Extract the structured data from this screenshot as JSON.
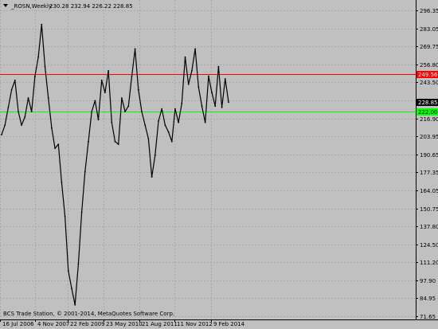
{
  "header": {
    "symbol": "_ROSN,Weekly",
    "ohlc": "230.28 232.94 226.22 228.85",
    "menu_icon": "triangle-down-icon"
  },
  "footer": {
    "copyright": "BCS Trade Station, © 2001-2014, MetaQuotes Software Corp."
  },
  "colors": {
    "background": "#c0c0c0",
    "grid": "#a8a8a8",
    "price_line": "#000000",
    "resistance_line": "#ff0000",
    "support_line": "#00ff00"
  },
  "chart_data": {
    "type": "line",
    "title": "",
    "xlabel": "",
    "ylabel": "",
    "y_axis_ticks": [
      "296.35",
      "283.05",
      "269.75",
      "256.80",
      "243.50",
      "230.20",
      "216.90",
      "203.95",
      "190.65",
      "177.35",
      "164.05",
      "150.75",
      "137.80",
      "124.50",
      "111.20",
      "97.90",
      "84.95",
      "71.65"
    ],
    "x_axis_ticks": [
      "16 Jul 2006",
      "4 Nov 2007",
      "22 Feb 2009",
      "23 May 2010",
      "21 Aug 2011",
      "11 Nov 2012",
      "9 Feb 2014"
    ],
    "ylim": [
      71.65,
      296.35
    ],
    "grid": true,
    "current_price": {
      "value": 228.85,
      "label": "228.85"
    },
    "horizontal_levels": [
      {
        "value": 249.56,
        "label": "249.56",
        "color": "#ff0000"
      },
      {
        "value": 222.0,
        "label": "222.00",
        "color": "#00ff00"
      }
    ],
    "series": [
      {
        "x": [
          "2006-07-16",
          "2006-08-27",
          "2006-10-08",
          "2006-11-19",
          "2006-12-31",
          "2007-02-11",
          "2007-03-25",
          "2007-05-06",
          "2007-06-17",
          "2007-07-29",
          "2007-09-09",
          "2007-10-21",
          "2007-12-02",
          "2008-01-13",
          "2008-02-24",
          "2008-04-06",
          "2008-05-18",
          "2008-06-29",
          "2008-08-10",
          "2008-09-21",
          "2008-11-02",
          "2008-12-14",
          "2009-01-25",
          "2009-03-08",
          "2009-04-19",
          "2009-05-31",
          "2009-07-12",
          "2009-08-23",
          "2009-10-04",
          "2009-11-15",
          "2009-12-27",
          "2010-02-07",
          "2010-03-21",
          "2010-05-02",
          "2010-06-13",
          "2010-07-25",
          "2010-09-05",
          "2010-10-17",
          "2010-11-28",
          "2011-01-09",
          "2011-02-20",
          "2011-04-03",
          "2011-05-15",
          "2011-06-26",
          "2011-08-07",
          "2011-09-18",
          "2011-10-30",
          "2011-12-11",
          "2012-01-22",
          "2012-03-04",
          "2012-04-15",
          "2012-05-27",
          "2012-07-08",
          "2012-08-19",
          "2012-09-30",
          "2012-11-11",
          "2012-12-23",
          "2013-02-03",
          "2013-03-17",
          "2013-04-28",
          "2013-06-09",
          "2013-07-21",
          "2013-09-01",
          "2013-10-13",
          "2013-11-24",
          "2014-01-05",
          "2014-02-16",
          "2014-03-30",
          "2014-05-11"
        ],
        "values": [
          205,
          212,
          225,
          238,
          245,
          222,
          212,
          218,
          232,
          222,
          248,
          262,
          286,
          255,
          232,
          210,
          195,
          198,
          170,
          145,
          105,
          92,
          80,
          110,
          148,
          178,
          200,
          222,
          230,
          216,
          245,
          236,
          252,
          214,
          200,
          198,
          232,
          222,
          226,
          248,
          268,
          238,
          222,
          212,
          202,
          174,
          190,
          215,
          224,
          212,
          207,
          200,
          224,
          214,
          228,
          262,
          242,
          252,
          268,
          240,
          226,
          214,
          248,
          236,
          226,
          255,
          225,
          246,
          228.85
        ]
      }
    ]
  }
}
